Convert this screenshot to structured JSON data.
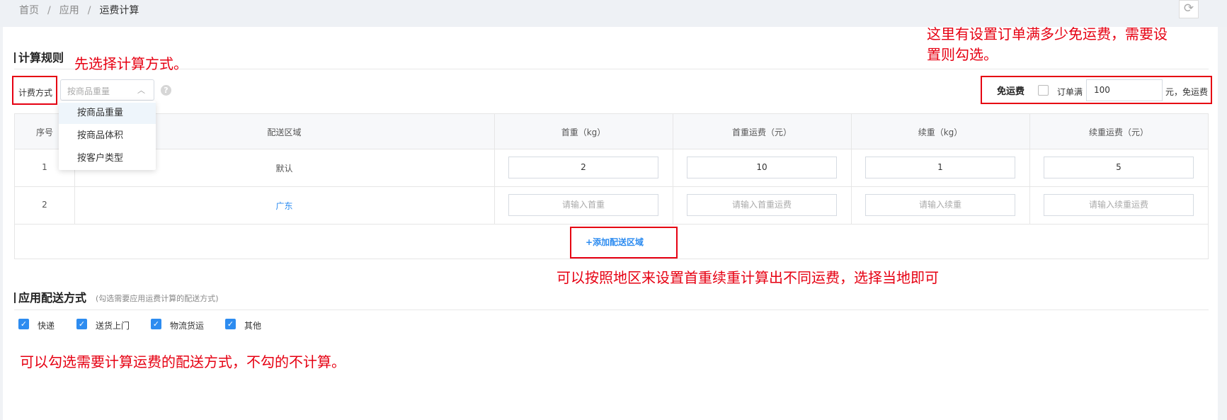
{
  "breadcrumb": [
    "首页",
    "应用",
    "运费计算"
  ],
  "section1": {
    "title": "计算规则"
  },
  "billing": {
    "label": "计费方式",
    "placeholder": "按商品重量",
    "options": [
      "按商品重量",
      "按商品体积",
      "按客户类型"
    ]
  },
  "free_shipping": {
    "label": "免运费",
    "checked": false,
    "prefix": "订单满",
    "value": "100",
    "suffix": "元，免运费"
  },
  "table": {
    "headers": [
      "序号",
      "配送区域",
      "首重（kg）",
      "首重运费（元）",
      "续重（kg）",
      "续重运费（元）"
    ],
    "rows": [
      {
        "index": "1",
        "region": "默认",
        "first_weight": "2",
        "first_fee": "10",
        "extra_weight": "1",
        "extra_fee": "5"
      },
      {
        "index": "2",
        "region": "广东",
        "first_weight_ph": "请输入首重",
        "first_fee_ph": "请输入首重运费",
        "extra_weight_ph": "请输入续重",
        "extra_fee_ph": "请输入续重运费"
      }
    ],
    "add_region": "+添加配送区域"
  },
  "section2": {
    "title": "应用配送方式",
    "hint": "(勾选需要应用运费计算的配送方式)",
    "methods": [
      {
        "label": "快递",
        "checked": true
      },
      {
        "label": "送货上门",
        "checked": true
      },
      {
        "label": "物流货运",
        "checked": true
      },
      {
        "label": "其他",
        "checked": true
      }
    ]
  },
  "annotations": {
    "select_method": "先选择计算方式。",
    "free_shipping_line1": "这里有设置订单满多少免运费，需要设",
    "free_shipping_line2": "置则勾选。",
    "region": "可以按照地区来设置首重续重计算出不同运费，选择当地即可",
    "methods": "可以勾选需要计算运费的配送方式，不勾的不计算。"
  },
  "colors": {
    "accent": "#2d8cf0",
    "annotation": "#e60012"
  }
}
